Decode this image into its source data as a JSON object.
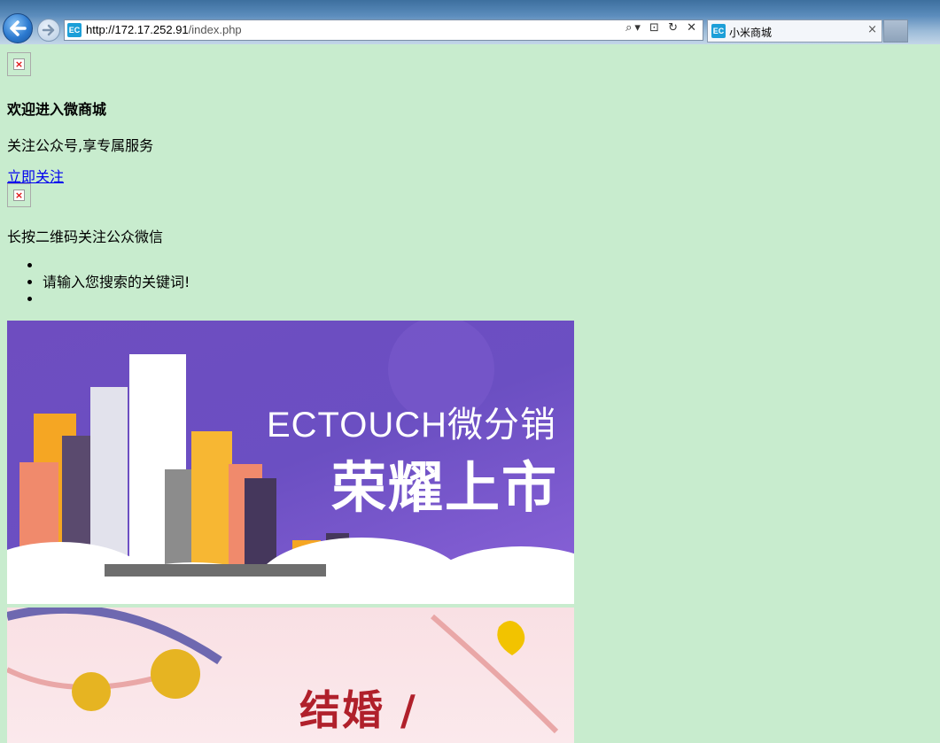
{
  "browser": {
    "url_host": "http://172.17.252.91",
    "url_path": "/index.php",
    "tab_title": "小米商城",
    "favicon_text": "EC",
    "address_tools": "⌕▾ ⊡ ↻ ✕",
    "tab_close": "×"
  },
  "page": {
    "title": "欢迎进入微商城",
    "subtitle": "关注公众号,享专属服务",
    "follow_link": "立即关注",
    "qr_hint": "长按二维码关注公众微信",
    "search_items": [
      "",
      "请输入您搜索的关键词!",
      ""
    ]
  },
  "banners": [
    {
      "line1": "ECTOUCH微分销",
      "line2": "荣耀上市",
      "background": "#6b4fc2"
    },
    {
      "text": "结婚 /",
      "background": "#f9e0e4"
    }
  ],
  "colors": {
    "page_background": "#c8ecce",
    "link": "#0000ee"
  }
}
